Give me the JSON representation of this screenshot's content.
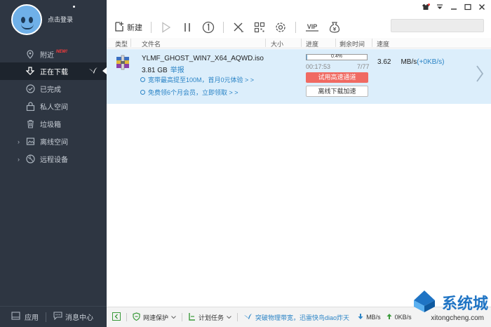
{
  "sidebar": {
    "login": "点击登录",
    "items": [
      {
        "label": "附近",
        "badge": "NEW!"
      },
      {
        "label": "正在下载"
      },
      {
        "label": "已完成"
      },
      {
        "label": "私人空间"
      },
      {
        "label": "垃圾箱"
      },
      {
        "label": "离线空间"
      },
      {
        "label": "远程设备"
      }
    ],
    "bottom": {
      "apps": "应用",
      "messages": "消息中心"
    }
  },
  "toolbar": {
    "new_label": "新建",
    "vip_label": "VIP"
  },
  "columns": [
    "类型",
    "文件名",
    "大小",
    "进度",
    "剩余时间",
    "速度"
  ],
  "download": {
    "filename": "YLMF_GHOST_WIN7_X64_AQWD.iso",
    "size": "3.81 GB",
    "source": "举报",
    "promo1": "宽带最高提至100M，首月0元体验 > >",
    "promo2": "免费领6个月会员，立即领取 > >",
    "progress_pct": 0.4,
    "progress_label": "0.4%",
    "remaining": "00:17:53",
    "count": "7/77",
    "btn_fast": "试用高速通道",
    "btn_offline": "离线下载加速",
    "speed_value": "3.62",
    "speed_unit": "MB/s",
    "speed_up": "(+0KB/s)"
  },
  "statusbar": {
    "protect": "网速保护",
    "plan": "计划任务",
    "promo": "突破物理带宽，迅雷快鸟diao炸天",
    "down_speed": "MB/s",
    "up_speed": "0KB/s"
  },
  "watermark": {
    "text": "系统城",
    "url": "xitongcheng.com"
  },
  "colors": {
    "sidebar": "#2e3642",
    "accent": "#2b84c6",
    "red_button": "#f06a62",
    "row_bg": "#dceefb"
  }
}
